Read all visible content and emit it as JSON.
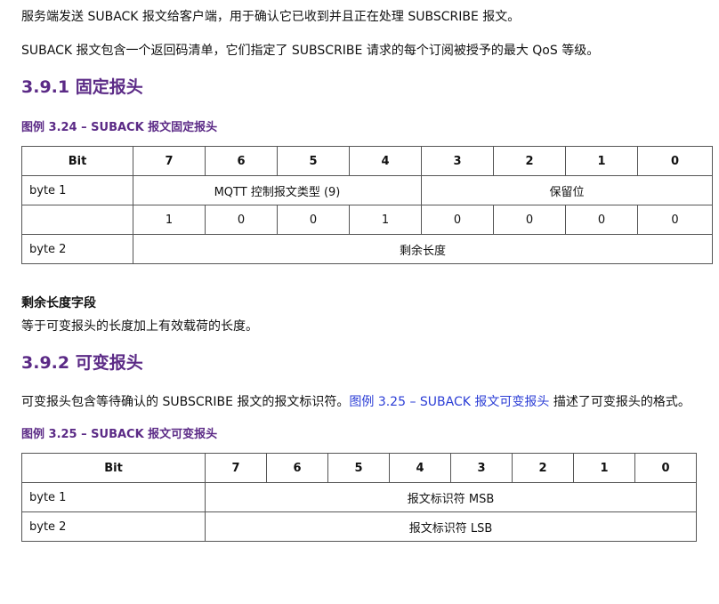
{
  "intro": {
    "para1": "服务端发送 SUBACK 报文给客户端，用于确认它已收到并且正在处理 SUBSCRIBE 报文。",
    "para2": "SUBACK 报文包含一个返回码清单，它们指定了 SUBSCRIBE 请求的每个订阅被授予的最大 QoS 等级。"
  },
  "section1": {
    "heading": "3.9.1 固定报头",
    "caption": "图例 3.24 – SUBACK 报文固定报头",
    "table": {
      "header": [
        "Bit",
        "7",
        "6",
        "5",
        "4",
        "3",
        "2",
        "1",
        "0"
      ],
      "row1_label": "byte 1",
      "row1_left": "MQTT 控制报文类型 (9)",
      "row1_right": "保留位",
      "bits_row_label": "",
      "bits": [
        "1",
        "0",
        "0",
        "1",
        "0",
        "0",
        "0",
        "0"
      ],
      "row2_label": "byte 2",
      "row2_value": "剩余长度"
    }
  },
  "remaining_length": {
    "heading": "剩余长度字段",
    "text": "等于可变报头的长度加上有效载荷的长度。"
  },
  "section2": {
    "heading": "3.9.2 可变报头",
    "text_before_link": "可变报头包含等待确认的 SUBSCRIBE 报文的报文标识符。",
    "link": "图例 3.25 – SUBACK 报文可变报头",
    "text_after_link": " 描述了可变报头的格式。",
    "caption": "图例 3.25 – SUBACK 报文可变报头",
    "table": {
      "header": [
        "Bit",
        "7",
        "6",
        "5",
        "4",
        "3",
        "2",
        "1",
        "0"
      ],
      "row1_label": "byte 1",
      "row1_value": "报文标识符 MSB",
      "row2_label": "byte 2",
      "row2_value": "报文标识符 LSB"
    }
  }
}
